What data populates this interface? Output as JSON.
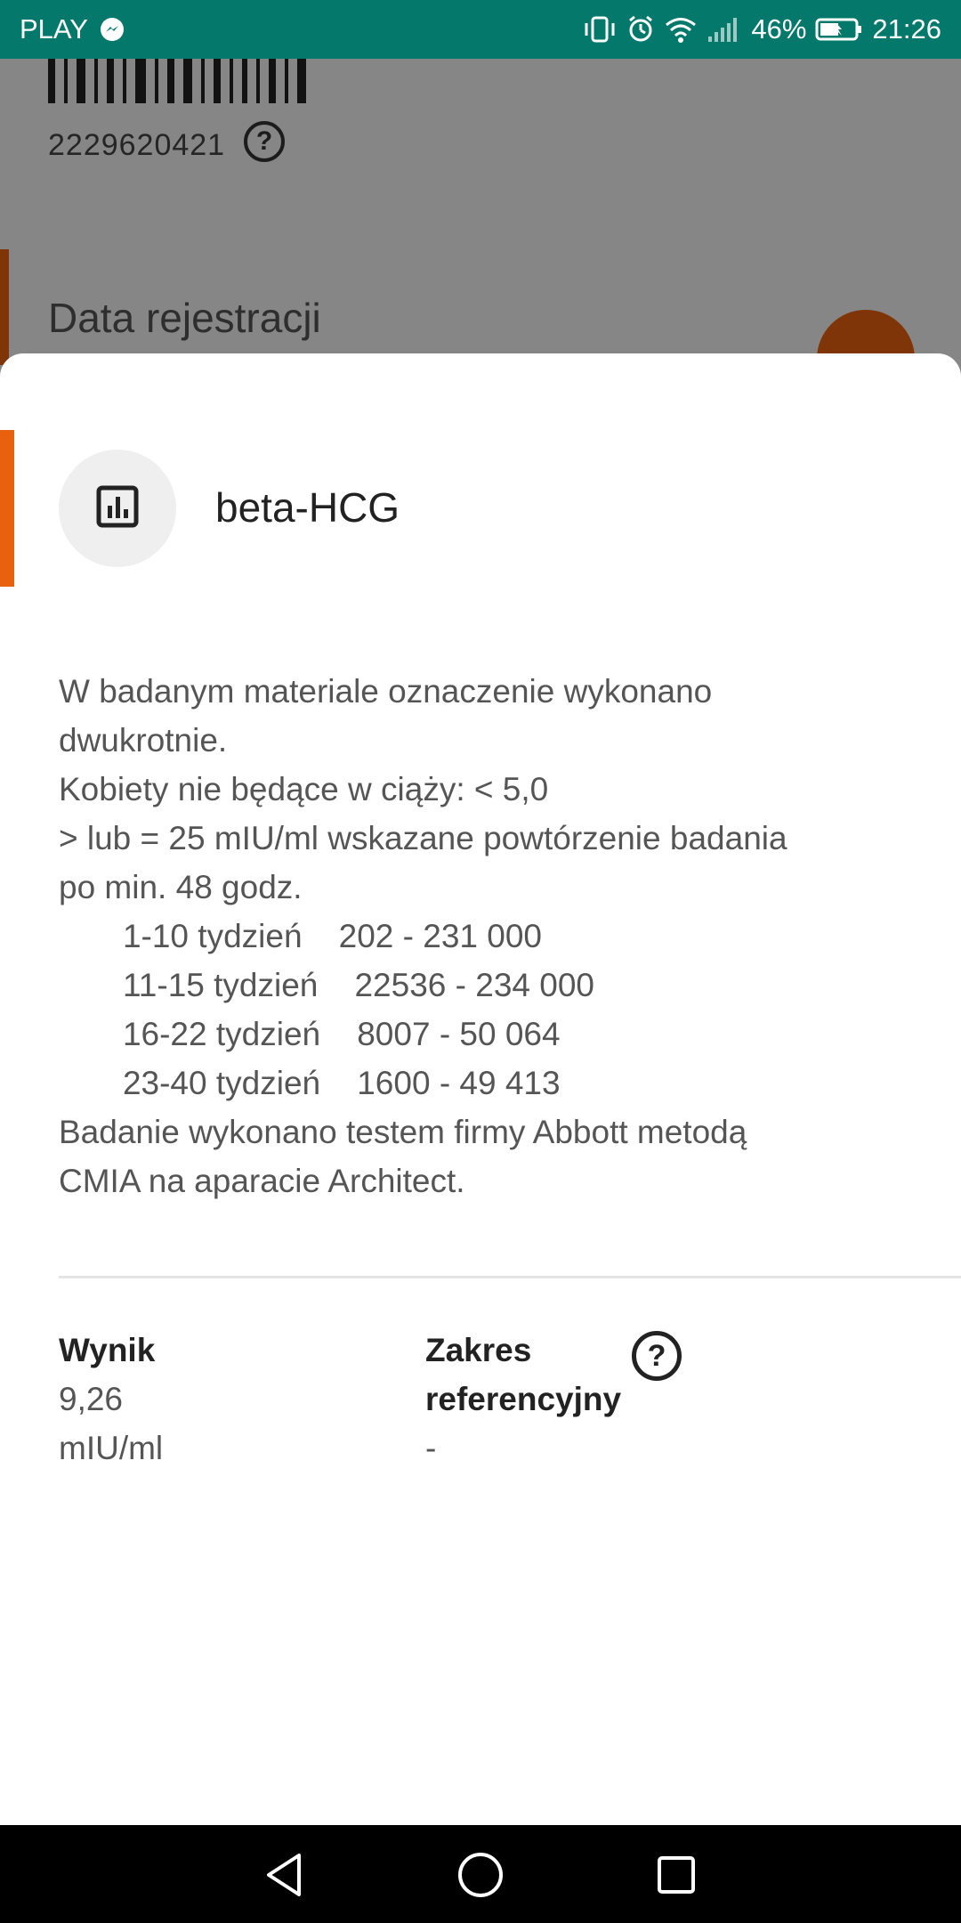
{
  "status_bar": {
    "carrier": "PLAY",
    "battery": "46%",
    "time": "21:26",
    "icons": [
      "messenger-icon",
      "vibrate-icon",
      "alarm-icon",
      "wifi-icon",
      "signal-icon",
      "battery-icon"
    ]
  },
  "background": {
    "barcode_number": "2229620421",
    "help_symbol": "?",
    "section_heading": "Data rejestracji"
  },
  "sheet": {
    "icon": "chart-icon",
    "title": "beta-HCG",
    "description_lines": [
      "W badanym materiale oznaczenie wykonano",
      "dwukrotnie.",
      "Kobiety nie będące w ciąży: < 5,0",
      "> lub = 25 mIU/ml wskazane powtórzenie badania",
      "po min. 48 godz.",
      "       1-10 tydzień    202 - 231 000",
      "       11-15 tydzień    22536 - 234 000",
      "       16-22 tydzień    8007 - 50 064",
      "       23-40 tydzień    1600 - 49 413",
      "Badanie wykonano testem firmy Abbott metodą",
      "CMIA na aparacie Architect."
    ],
    "result": {
      "label": "Wynik",
      "value": "9,26",
      "unit": "mIU/ml"
    },
    "reference": {
      "label_line1": "Zakres",
      "label_line2": "referencyjny",
      "value": "-",
      "help_symbol": "?"
    }
  },
  "colors": {
    "status_bar": "#05786c",
    "accent": "#e8610e",
    "nav_bar": "#000000"
  }
}
